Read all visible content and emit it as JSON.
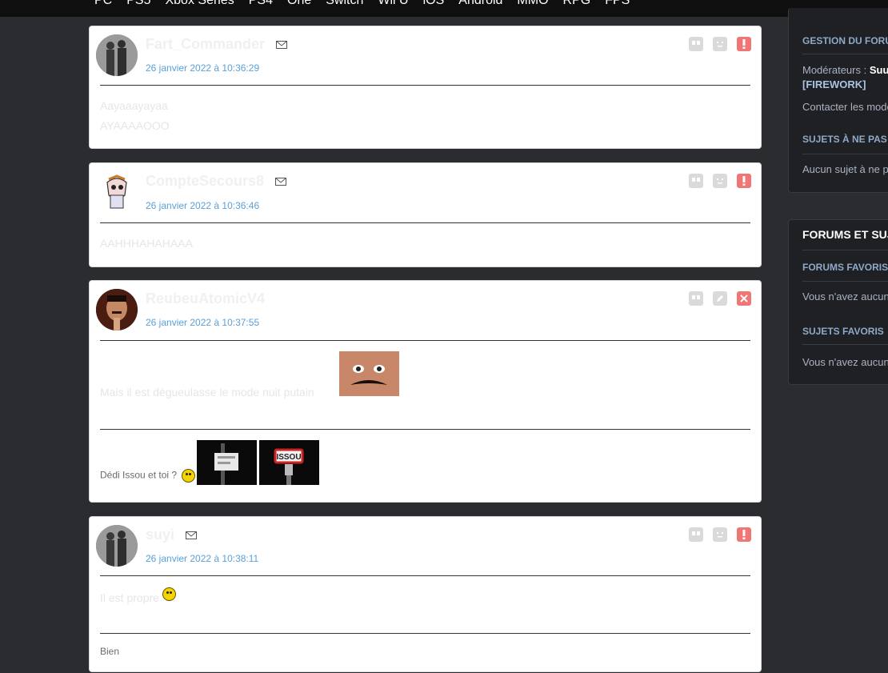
{
  "nav": [
    "PC",
    "PS5",
    "Xbox Series",
    "PS4",
    "One",
    "Switch",
    "Wii U",
    "iOS",
    "Android",
    "MMO",
    "RPG",
    "FPS"
  ],
  "posts": [
    {
      "author": "Fart_Commander",
      "date": "26 janvier 2022 à 10:36:29",
      "lines": [
        "Aayaaayayaa",
        "AYAAAAOOO"
      ]
    },
    {
      "author": "CompteSecours8",
      "date": "26 janvier 2022 à 10:36:46",
      "lines": [
        "AAHHHAHAHAAA"
      ]
    },
    {
      "author": "ReubeuAtomicV4",
      "date": "26 janvier 2022 à 10:37:55",
      "lines": [
        "Mais il est dégueulasse le mode nuit putain"
      ],
      "signature": "Dédi Issou et toi ?",
      "signature_image_label": "ISSOU"
    },
    {
      "author": "suyi",
      "date": "26 janvier 2022 à 10:38:11",
      "lines": [
        "Il est propre"
      ],
      "signature": "Bien"
    }
  ],
  "sidebar": {
    "gestion_title": "GESTION DU FORUM",
    "moderateurs_label": "Modérateurs :",
    "moderateurs_name": "Suu",
    "moderateurs_more": "[FIREWORK]",
    "contacter": "Contacter les modérateurs",
    "sujets_ne_pas_title": "SUJETS À NE PAS",
    "aucun_sujet": "Aucun sujet à ne pas",
    "forums_sujets_title": "FORUMS ET SUJETS",
    "forums_favoris_title": "FORUMS FAVORIS",
    "forums_favoris_text": "Vous n'avez aucun",
    "sujets_favoris_title": "SUJETS FAVORIS",
    "sujets_favoris_text": "Vous n'avez aucun"
  },
  "colors": {
    "background": "#2b2c30",
    "date_link": "#5aa0d8",
    "alert": "#f07575"
  }
}
